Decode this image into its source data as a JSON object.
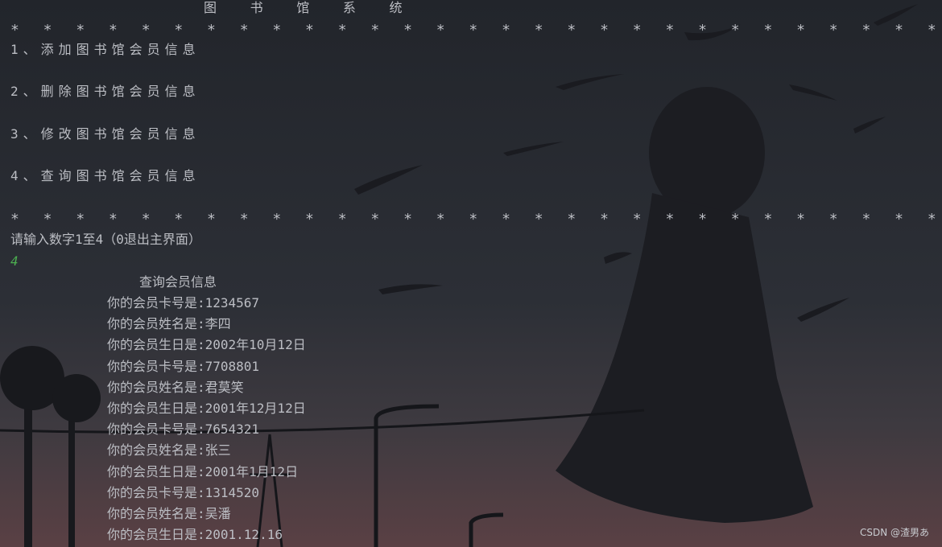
{
  "title": "图 书 馆 系 统",
  "separator_star": "*",
  "separator_count": 29,
  "menu": [
    "1、添加图书馆会员信息",
    "2、删除图书馆会员信息",
    "3、修改图书馆会员信息",
    "4、查询图书馆会员信息"
  ],
  "prompt": "请输入数字1至4（0退出主界面）",
  "input": "4",
  "query_title": "查询会员信息",
  "records": [
    "你的会员卡号是:1234567",
    "你的会员姓名是:李四",
    "你的会员生日是:2002年10月12日",
    "你的会员卡号是:7708801",
    "你的会员姓名是:君莫笑",
    "你的会员生日是:2001年12月12日",
    "你的会员卡号是:7654321",
    "你的会员姓名是:张三",
    "你的会员生日是:2001年1月12日",
    "你的会员卡号是:1314520",
    "你的会员姓名是:吴潘",
    "你的会员生日是:2001.12.16"
  ],
  "watermark": "CSDN @渣男あ",
  "colors": {
    "text": "#bcbec4",
    "input": "#4caf50",
    "background": "#2b2d33"
  }
}
